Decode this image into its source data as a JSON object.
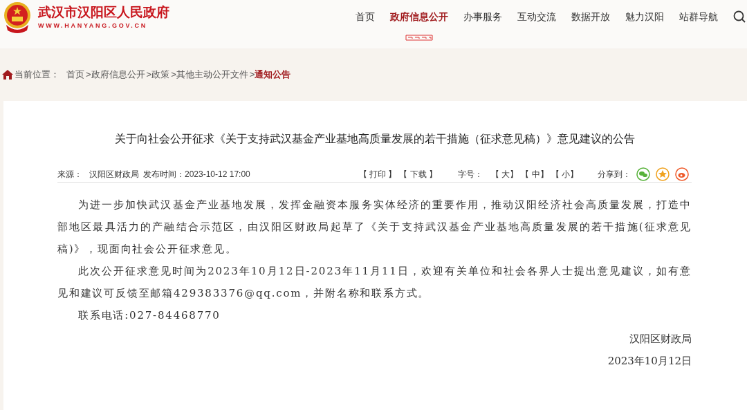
{
  "site": {
    "name": "武汉市汉阳区人民政府",
    "url": "WWW.HANYANG.GOV.CN"
  },
  "nav": [
    {
      "label": "首页",
      "selected": false
    },
    {
      "label": "政府信息公开",
      "selected": true
    },
    {
      "label": "办事服务",
      "selected": false
    },
    {
      "label": "互动交流",
      "selected": false
    },
    {
      "label": "数据开放",
      "selected": false
    },
    {
      "label": "魅力汉阳",
      "selected": false
    },
    {
      "label": "站群导航",
      "selected": false
    }
  ],
  "breadcrumb": {
    "prefix": "当前位置：",
    "items": [
      {
        "label": "首页",
        "current": false
      },
      {
        "label": "政府信息公开",
        "current": false
      },
      {
        "label": "政策",
        "current": false
      },
      {
        "label": "其他主动公开文件",
        "current": false
      },
      {
        "label": "通知公告",
        "current": true
      }
    ],
    "separator": ">"
  },
  "article": {
    "title": "关于向社会公开征求《关于支持武汉基金产业基地高质量发展的若干措施（征求意见稿）》意见建议的公告",
    "source_label": "来源：",
    "source": "汉阳区财政局",
    "time_label": "发布时间：",
    "time": "2023-10-12 17:00",
    "actions": [
      "【 打印 】",
      "【 下载 】"
    ],
    "font_size_label": "字号：",
    "font_sizes": [
      "【 大】",
      "【 中】",
      "【 小】"
    ],
    "share_label": "分享到：",
    "paragraphs": [
      "为进一步加快武汉基金产业基地发展，发挥金融资本服务实体经济的重要作用，推动汉阳经济社会高质量发展，打造中部地区最具活力的产融结合示范区，由汉阳区财政局起草了《关于支持武汉基金产业基地高质量发展的若干措施(征求意见稿)》，现面向社会公开征求意见。",
      "此次公开征求意见时间为2023年10月12日-2023年11月11日，欢迎有关单位和社会各界人士提出意见建议，如有意见和建议可反馈至邮箱429383376@qq.com，并附名称和联系方式。",
      "联系电话:027-84468770"
    ],
    "signature": "汉阳区财政局",
    "date": "2023年10月12日"
  }
}
